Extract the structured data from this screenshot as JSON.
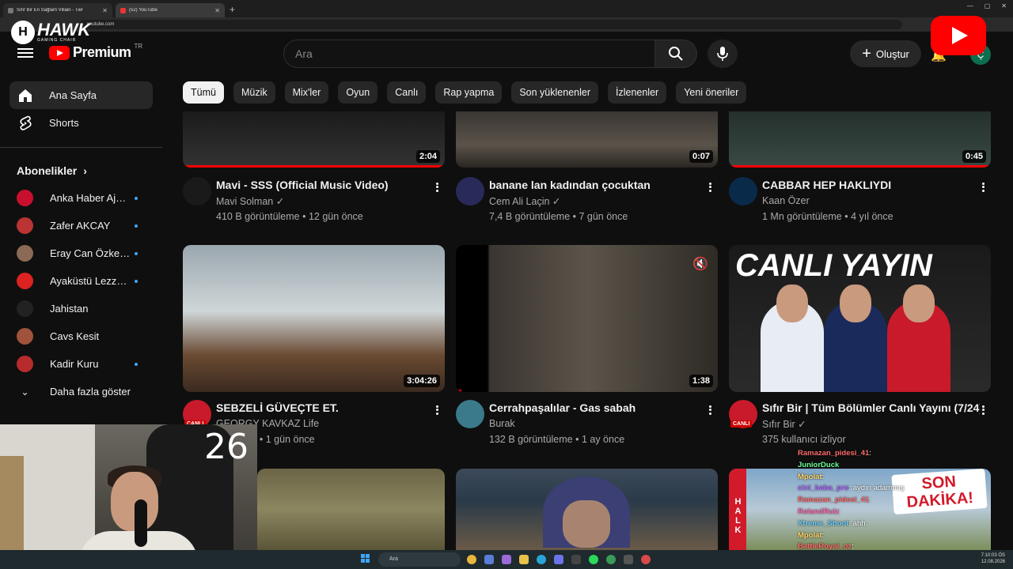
{
  "browser": {
    "tabs": [
      {
        "title": "Sıfır Bir En Sağlam Villain - Tier"
      },
      {
        "title": "(52) YouTube"
      }
    ],
    "address": "youtube.com"
  },
  "overlay": {
    "hawk_brand": "HAWK",
    "hawk_sub": "GAMING CHAIR",
    "webcam_counter": "26"
  },
  "masthead": {
    "logo_text": "Premium",
    "region": "TR",
    "search_placeholder": "Ara",
    "create_label": "Oluştur",
    "avatar_initial": "Ç"
  },
  "sidebar": {
    "items": [
      {
        "label": "Ana Sayfa",
        "icon": "home-icon"
      },
      {
        "label": "Shorts",
        "icon": "shorts-icon"
      }
    ],
    "subscriptions_heading": "Abonelikler",
    "subscriptions": [
      {
        "name": "Anka Haber Ajansı",
        "color": "#c8102e",
        "new": true
      },
      {
        "name": "Zafer AKCAY",
        "color": "#b33",
        "new": true
      },
      {
        "name": "Eray Can Özkenar",
        "color": "#8a6a55",
        "new": true
      },
      {
        "name": "Ayaküstü Lezzetl...",
        "color": "#d22",
        "new": true
      },
      {
        "name": "Jahistan",
        "color": "#222",
        "new": false
      },
      {
        "name": "Cavs Kesit",
        "color": "#a0523a",
        "new": false
      },
      {
        "name": "Kadir Kuru",
        "color": "#b62b2b",
        "new": true
      }
    ],
    "show_more": "Daha fazla göster"
  },
  "chips": [
    "Tümü",
    "Müzik",
    "Mix'ler",
    "Oyun",
    "Canlı",
    "Rap yapma",
    "Son yüklenenler",
    "İzlenenler",
    "Yeni öneriler"
  ],
  "videos": [
    {
      "title": "Mavi - SSS (Official Music Video)",
      "channel": "Mavi Solman",
      "verified": true,
      "meta": "410 B görüntüleme • 12 gün önce",
      "duration": "2:04",
      "progress": 1.0
    },
    {
      "title": "banane lan kadından çocuktan",
      "channel": "Cem Ali Laçin",
      "verified": true,
      "meta": "7,4 B görüntüleme • 7 gün önce",
      "duration": "0:07",
      "progress": 0
    },
    {
      "title": "CABBAR HEP HAKLIYDI",
      "channel": "Kaan Özer",
      "verified": false,
      "meta": "1 Mn görüntüleme • 4 yıl önce",
      "duration": "0:45",
      "progress": 1.0
    },
    {
      "title": "SEBZELİ GÜVEÇTE ET.",
      "channel": "GEORGY KAVKAZ Life",
      "verified": false,
      "meta": "üntüleme • 1 gün önce",
      "duration": "3:04:26",
      "progress": 0,
      "badge": "CANLI"
    },
    {
      "title": "Cerrahpaşalılar - Gas sabah",
      "channel": "Burak",
      "verified": false,
      "meta": "132 B görüntüleme • 1 ay önce",
      "duration": "1:38",
      "progress": 0.02
    },
    {
      "title": "Sıfır Bir | Tüm Bölümler Canlı Yayını (7/24)",
      "channel": "Sıfır Bir",
      "verified": true,
      "meta": "375 kullanıcı izliyor",
      "duration": "",
      "progress": 0,
      "badge": "CANLI",
      "thumb_text": "CANLI YAYIN"
    }
  ],
  "bottom_thumbs": {
    "right_text": "SON DAKİKA!",
    "right_side": "HALK"
  },
  "chat": [
    {
      "user": "Ramazan_pidesi_41",
      "msg": ":"
    },
    {
      "user": "JuniorDuck",
      "msg": ""
    },
    {
      "user": "Mpolat",
      "msg": ":"
    },
    {
      "user": "cini_baba_pro",
      "msg": ": aydın adammış"
    },
    {
      "user": "Ramazan_pidesi_41",
      "msg": ":"
    },
    {
      "user": "RolandRuiz",
      "msg": ":"
    },
    {
      "user": "Xtreme_Shoot",
      "msg": ": ahh."
    },
    {
      "user": "Mpolat",
      "msg": ":"
    },
    {
      "user": "BattleRoyal_oz",
      "msg": ":"
    }
  ],
  "taskbar": {
    "search": "Ara",
    "time": "7:10:03 ÖS",
    "date": "12.08.2026"
  },
  "colors": {
    "background": "#0f0f0f",
    "chip_bg": "#272727",
    "accent_red": "#ff0000",
    "new_dot": "#3ea6ff"
  }
}
